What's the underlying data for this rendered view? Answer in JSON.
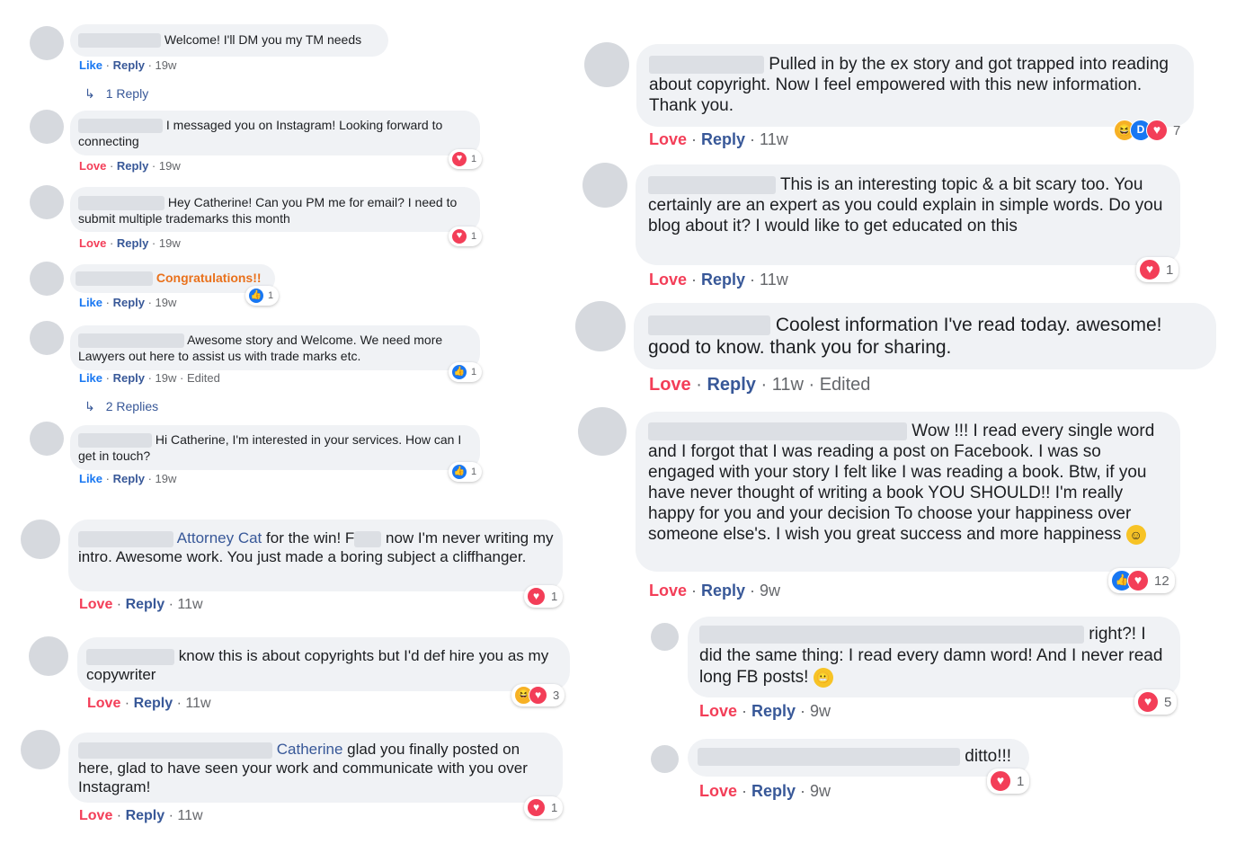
{
  "left": [
    {
      "pre": "",
      "text": "Welcome! I'll DM you my TM needs",
      "actions": [
        "Like",
        "Reply",
        "19w"
      ],
      "replies": "1 Reply"
    },
    {
      "pre": "",
      "text": "I messaged you on Instagram! Looking forward to connecting",
      "actions": [
        "Love",
        "Reply",
        "19w"
      ],
      "reaction_count": "1"
    },
    {
      "pre": "",
      "text": "Hey Catherine! Can you PM me for email? I need to submit multiple trademarks this month",
      "actions": [
        "Love",
        "Reply",
        "19w"
      ],
      "reaction_count": "1"
    },
    {
      "pre": "",
      "text": "Congratulations!!",
      "actions": [
        "Like",
        "Reply",
        "19w"
      ],
      "reaction_count": "1"
    },
    {
      "pre": "",
      "text": "Awesome story and Welcome. We need more Lawyers out here to assist us with trade marks etc.",
      "actions": [
        "Like",
        "Reply",
        "19w",
        "Edited"
      ],
      "reaction_count": "1",
      "replies": "2 Replies"
    },
    {
      "pre": "",
      "text": "Hi Catherine, I'm interested in your services. How can I get in touch?",
      "actions": [
        "Like",
        "Reply",
        "19w"
      ],
      "reaction_count": "1"
    },
    {
      "pre": "Attorney Cat",
      "text": " for the win! F",
      "text2": " now I'm never writing my intro. Awesome work. You just made a boring subject a cliffhanger.",
      "actions": [
        "Love",
        "Reply",
        "11w"
      ],
      "reaction_count": "1"
    },
    {
      "pre": "",
      "text": "know this is about copyrights but I'd def hire you as my copywriter",
      "actions": [
        "Love",
        "Reply",
        "11w"
      ],
      "reaction_count": "3"
    },
    {
      "pre": "Catherine",
      "text": " glad you finally posted on here, glad to have seen your work and communicate with you over Instagram!",
      "actions": [
        "Love",
        "Reply",
        "11w"
      ],
      "reaction_count": "1"
    }
  ],
  "right": [
    {
      "text": "Pulled in by the ex story and got trapped into reading about copyright. Now I feel empowered with this new information. Thank you.",
      "actions": [
        "Love",
        "Reply",
        "11w"
      ],
      "reaction_count": "7"
    },
    {
      "text": "This is an interesting topic & a bit scary too. You certainly are an expert as you could explain in simple words. Do you blog about it? I would like to get educated on this",
      "actions": [
        "Love",
        "Reply",
        "11w"
      ],
      "reaction_count": "1"
    },
    {
      "text": "Coolest information I've read today. awesome! good to know. thank you for sharing.",
      "actions": [
        "Love",
        "Reply",
        "11w",
        "Edited"
      ]
    },
    {
      "text": "Wow !!! I read every single word and I forgot that I was reading a post on Facebook. I was so engaged with your story I felt like I was reading a book. Btw, if you have never thought of writing a book YOU SHOULD!! I'm really happy for you and your decision To choose your happiness over someone else's. I wish you great success and more happiness",
      "actions": [
        "Love",
        "Reply",
        "9w"
      ],
      "reaction_count": "12"
    },
    {
      "text": "right?! I did the same thing: I read every damn word! And I never read long FB posts!",
      "actions": [
        "Love",
        "Reply",
        "9w"
      ],
      "reaction_count": "5"
    },
    {
      "text": "ditto!!!",
      "actions": [
        "Love",
        "Reply",
        "9w"
      ],
      "reaction_count": "1"
    }
  ],
  "icons": {
    "love": "heart-icon",
    "like": "thumbs-up-icon",
    "haha": "haha-icon",
    "wow": "wow-icon",
    "smile": "smile-emoji",
    "grimace": "grimace-emoji",
    "reply_arrow": "reply-arrow-icon"
  },
  "colors": {
    "love": "#f33e58",
    "like": "#1877f2",
    "link": "#385898",
    "bubble": "#f0f2f5",
    "meta": "#65676b"
  }
}
